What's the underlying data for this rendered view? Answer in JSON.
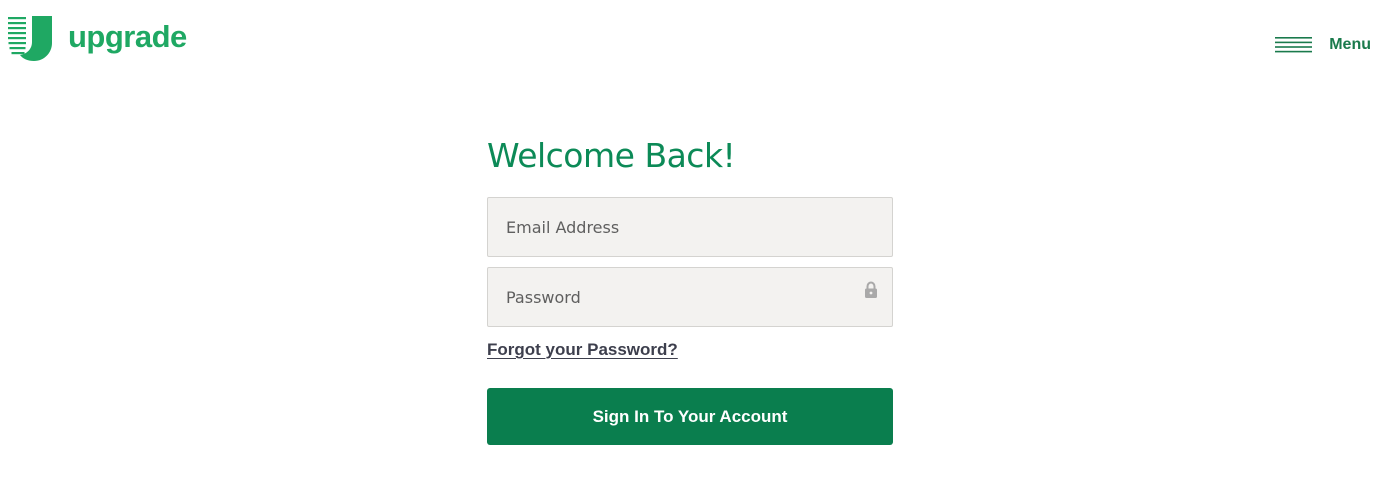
{
  "brand": {
    "logo_icon": "upgrade-shield-logo",
    "name": "upgrade",
    "color": "#1fa863"
  },
  "nav": {
    "menu_icon": "hamburger-icon",
    "menu_label": "Menu"
  },
  "login": {
    "title": "Welcome Back!",
    "email": {
      "value": "",
      "placeholder": "Email Address"
    },
    "password": {
      "value": "",
      "placeholder": "Password",
      "icon": "lock-icon"
    },
    "forgot_label": "Forgot your Password?",
    "submit_label": "Sign In To Your Account"
  },
  "colors": {
    "accent": "#0a7e4e",
    "title": "#0c8a57",
    "input_bg": "#f3f2f0",
    "link": "#3d3f4d"
  }
}
